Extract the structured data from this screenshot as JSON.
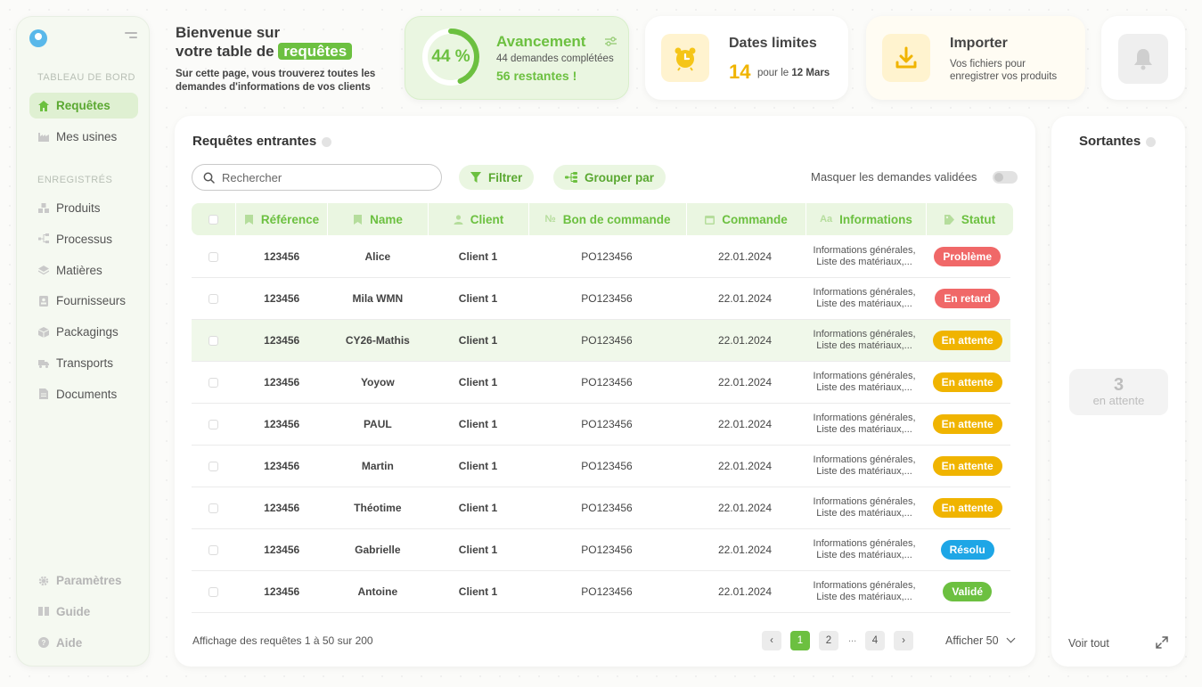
{
  "sidebar": {
    "section_dashboard": "TABLEAU DE BORD",
    "section_saved": "ENREGISTRÉS",
    "items_main": [
      {
        "label": "Requêtes",
        "icon": "home-icon",
        "active": true
      },
      {
        "label": "Mes usines",
        "icon": "factory-icon",
        "active": false
      }
    ],
    "items_saved": [
      {
        "label": "Produits",
        "icon": "boxes-icon"
      },
      {
        "label": "Processus",
        "icon": "process-icon"
      },
      {
        "label": "Matières",
        "icon": "layers-icon"
      },
      {
        "label": "Fournisseurs",
        "icon": "supplier-icon"
      },
      {
        "label": "Packagings",
        "icon": "package-icon"
      },
      {
        "label": "Transports",
        "icon": "truck-icon"
      },
      {
        "label": "Documents",
        "icon": "document-icon"
      }
    ],
    "items_bottom": [
      {
        "label": "Paramètres",
        "icon": "gear-icon"
      },
      {
        "label": "Guide",
        "icon": "book-icon"
      },
      {
        "label": "Aide",
        "icon": "help-icon"
      }
    ]
  },
  "welcome": {
    "title_line1": "Bienvenue sur",
    "title_line2_prefix": "votre table de",
    "title_highlight": "requêtes",
    "subtitle": "Sur cette page, vous trouverez toutes les demandes d'informations de vos clients"
  },
  "progress": {
    "percent_label": "44 %",
    "percent_value": 44,
    "title": "Avancement",
    "completed": "44 demandes complétées",
    "remaining": "56 restantes !"
  },
  "deadline": {
    "title": "Dates limites",
    "count": "14",
    "for_prefix": "pour le",
    "date": "12 Mars"
  },
  "import": {
    "title": "Importer",
    "subtitle": "Vos fichiers pour enregistrer vos produits"
  },
  "incoming": {
    "title": "Requêtes entrantes",
    "search_placeholder": "Rechercher",
    "filter_label": "Filtrer",
    "group_label": "Grouper par",
    "hide_validated_label": "Masquer les demandes validées",
    "columns": [
      "Référence",
      "Name",
      "Client",
      "Bon de commande",
      "Commande",
      "Informations",
      "Statut"
    ],
    "rows": [
      {
        "ref": "123456",
        "name": "Alice",
        "client": "Client 1",
        "po": "PO123456",
        "date": "22.01.2024",
        "info1": "Informations générales,",
        "info2": "Liste des matériaux,...",
        "status": "Problème",
        "status_color": "#f06868"
      },
      {
        "ref": "123456",
        "name": "Mila WMN",
        "client": "Client 1",
        "po": "PO123456",
        "date": "22.01.2024",
        "info1": "Informations générales,",
        "info2": "Liste des matériaux,...",
        "status": "En retard",
        "status_color": "#f06868"
      },
      {
        "ref": "123456",
        "name": "CY26-Mathis",
        "client": "Client 1",
        "po": "PO123456",
        "date": "22.01.2024",
        "info1": "Informations générales,",
        "info2": "Liste des matériaux,...",
        "status": "En attente",
        "status_color": "#f0b400"
      },
      {
        "ref": "123456",
        "name": "Yoyow",
        "client": "Client 1",
        "po": "PO123456",
        "date": "22.01.2024",
        "info1": "Informations générales,",
        "info2": "Liste des matériaux,...",
        "status": "En attente",
        "status_color": "#f0b400"
      },
      {
        "ref": "123456",
        "name": "PAUL",
        "client": "Client 1",
        "po": "PO123456",
        "date": "22.01.2024",
        "info1": "Informations générales,",
        "info2": "Liste des matériaux,...",
        "status": "En attente",
        "status_color": "#f0b400"
      },
      {
        "ref": "123456",
        "name": "Martin",
        "client": "Client 1",
        "po": "PO123456",
        "date": "22.01.2024",
        "info1": "Informations générales,",
        "info2": "Liste des matériaux,...",
        "status": "En attente",
        "status_color": "#f0b400"
      },
      {
        "ref": "123456",
        "name": "Théotime",
        "client": "Client 1",
        "po": "PO123456",
        "date": "22.01.2024",
        "info1": "Informations générales,",
        "info2": "Liste des matériaux,...",
        "status": "En attente",
        "status_color": "#f0b400"
      },
      {
        "ref": "123456",
        "name": "Gabrielle",
        "client": "Client 1",
        "po": "PO123456",
        "date": "22.01.2024",
        "info1": "Informations générales,",
        "info2": "Liste des matériaux,...",
        "status": "Résolu",
        "status_color": "#1ea6e6"
      },
      {
        "ref": "123456",
        "name": "Antoine",
        "client": "Client 1",
        "po": "PO123456",
        "date": "22.01.2024",
        "info1": "Informations générales,",
        "info2": "Liste des matériaux,...",
        "status": "Validé",
        "status_color": "#6cc040"
      }
    ],
    "pagination_info": "Affichage des requêtes 1 à 50 sur 200",
    "pages": [
      "1",
      "2",
      "...",
      "4"
    ],
    "show_label": "Afficher 50"
  },
  "outgoing": {
    "title": "Sortantes",
    "pending_count": "3",
    "pending_label": "en attente",
    "see_all": "Voir tout"
  },
  "colors": {
    "accent": "#6cc040",
    "accent_light": "#eaf6e1",
    "warning": "#f0b400",
    "danger": "#f06868",
    "info": "#1ea6e6"
  }
}
